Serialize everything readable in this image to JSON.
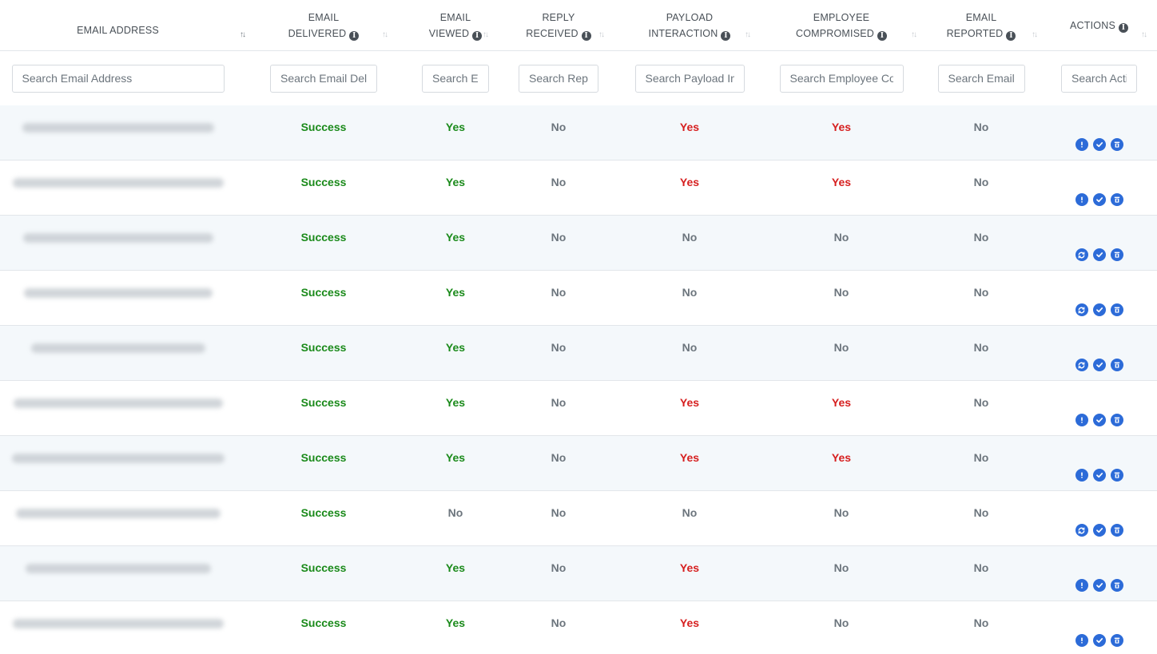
{
  "columns": [
    {
      "line1": "EMAIL ADDRESS",
      "line2": "",
      "info": false,
      "placeholder": "Search Email Address",
      "input_width": 266
    },
    {
      "line1": "EMAIL",
      "line2": "DELIVERED",
      "info": true,
      "placeholder": "Search Email Deli",
      "input_width": 134
    },
    {
      "line1": "EMAIL",
      "line2": "VIEWED",
      "info": true,
      "placeholder": "Search Er",
      "input_width": 84
    },
    {
      "line1": "REPLY",
      "line2": "RECEIVED",
      "info": true,
      "placeholder": "Search Repl",
      "input_width": 100
    },
    {
      "line1": "PAYLOAD",
      "line2": "INTERACTION",
      "info": true,
      "placeholder": "Search Payload In",
      "input_width": 137
    },
    {
      "line1": "EMPLOYEE",
      "line2": "COMPROMISED",
      "info": true,
      "placeholder": "Search Employee Co",
      "input_width": 155
    },
    {
      "line1": "EMAIL",
      "line2": "REPORTED",
      "info": true,
      "placeholder": "Search Email",
      "input_width": 109
    },
    {
      "line1": "ACTIONS",
      "line2": "",
      "info": true,
      "placeholder": "Search Acti",
      "input_width": 95
    }
  ],
  "info_glyph": "i",
  "sort_glyph": "↑↓",
  "rows": [
    {
      "delivered": "Success",
      "viewed": "Yes",
      "reply": "No",
      "payload": "Yes",
      "compromised": "Yes",
      "reported": "No",
      "first_action": "alert-icon"
    },
    {
      "delivered": "Success",
      "viewed": "Yes",
      "reply": "No",
      "payload": "Yes",
      "compromised": "Yes",
      "reported": "No",
      "first_action": "alert-icon"
    },
    {
      "delivered": "Success",
      "viewed": "Yes",
      "reply": "No",
      "payload": "No",
      "compromised": "No",
      "reported": "No",
      "first_action": "refresh-icon"
    },
    {
      "delivered": "Success",
      "viewed": "Yes",
      "reply": "No",
      "payload": "No",
      "compromised": "No",
      "reported": "No",
      "first_action": "refresh-icon"
    },
    {
      "delivered": "Success",
      "viewed": "Yes",
      "reply": "No",
      "payload": "No",
      "compromised": "No",
      "reported": "No",
      "first_action": "refresh-icon"
    },
    {
      "delivered": "Success",
      "viewed": "Yes",
      "reply": "No",
      "payload": "Yes",
      "compromised": "Yes",
      "reported": "No",
      "first_action": "alert-icon"
    },
    {
      "delivered": "Success",
      "viewed": "Yes",
      "reply": "No",
      "payload": "Yes",
      "compromised": "Yes",
      "reported": "No",
      "first_action": "alert-icon"
    },
    {
      "delivered": "Success",
      "viewed": "No",
      "reply": "No",
      "payload": "No",
      "compromised": "No",
      "reported": "No",
      "first_action": "refresh-icon"
    },
    {
      "delivered": "Success",
      "viewed": "Yes",
      "reply": "No",
      "payload": "Yes",
      "compromised": "No",
      "reported": "No",
      "first_action": "alert-icon"
    },
    {
      "delivered": "Success",
      "viewed": "Yes",
      "reply": "No",
      "payload": "Yes",
      "compromised": "No",
      "reported": "No",
      "first_action": "alert-icon"
    }
  ],
  "colors": {
    "success": "#1a8a1a",
    "yes_viewed": "#1a8a1a",
    "yes_risk": "#d61f1f",
    "no": "#6c757d",
    "action_icon": "#2c6bd8",
    "stripe": "#f4f8fb"
  },
  "action_icons": [
    "alert-icon",
    "check-icon",
    "trash-icon"
  ]
}
